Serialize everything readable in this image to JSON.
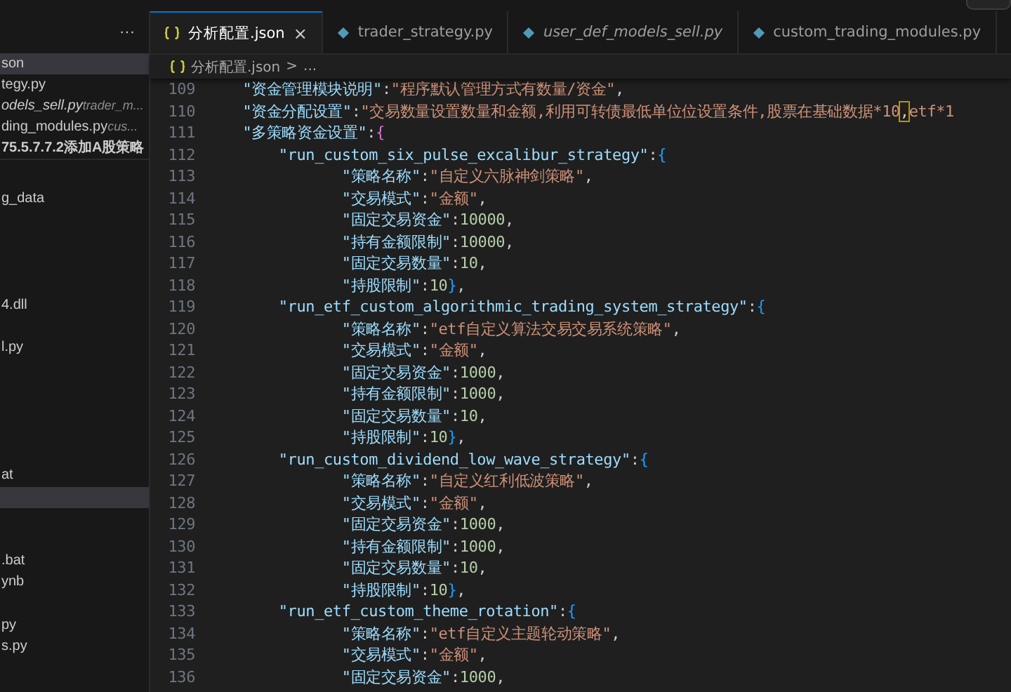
{
  "sidebar": {
    "more": "···",
    "open_editors": [
      {
        "label": "son",
        "selected": true,
        "italic": false
      },
      {
        "label": "tegy.py",
        "selected": false,
        "italic": false
      },
      {
        "label": "odels_sell.py",
        "detail": "trader_m...",
        "selected": false,
        "italic": true
      },
      {
        "label": "ding_modules.py",
        "detail": "cus...",
        "selected": false,
        "italic": false
      }
    ],
    "folder": "75.5.7.7.2添加A股策略",
    "tree": [
      {
        "label": "g_data",
        "selected": false
      },
      {
        "selected": false
      },
      {
        "selected": false
      },
      {
        "selected": false
      },
      {
        "selected": false
      },
      {
        "label": "4.dll",
        "selected": false
      },
      {
        "selected": false
      },
      {
        "label": "l.py",
        "selected": false
      },
      {
        "selected": false
      },
      {
        "selected": false
      },
      {
        "selected": false
      },
      {
        "selected": false
      },
      {
        "selected": false
      },
      {
        "label": "at",
        "selected": false
      },
      {
        "selected": true
      },
      {
        "selected": false
      },
      {
        "selected": false
      },
      {
        "label": ".bat",
        "selected": false
      },
      {
        "label": "ynb",
        "selected": false
      },
      {
        "selected": false
      },
      {
        "label": "py",
        "selected": false
      },
      {
        "label": "s.py",
        "selected": false
      }
    ]
  },
  "tabs": [
    {
      "label": "分析配置.json",
      "kind": "json",
      "selected": true,
      "italic": false,
      "close": "×"
    },
    {
      "label": "trader_strategy.py",
      "kind": "python",
      "selected": false,
      "italic": false
    },
    {
      "label": "user_def_models_sell.py",
      "kind": "python",
      "selected": false,
      "italic": true
    },
    {
      "label": "custom_trading_modules.py",
      "kind": "python",
      "selected": false,
      "italic": false
    }
  ],
  "breadcrumb": {
    "file": "分析配置.json",
    "separator": ">",
    "more": "..."
  },
  "lines": [
    {
      "number": "109",
      "tokens": [
        {
          "kind": "key",
          "text": "    \"资金管理模块说明\""
        },
        {
          "kind": "punct",
          "text": ":"
        },
        {
          "kind": "str",
          "text": "\"程序默认管理方式有数量/资金\""
        },
        {
          "kind": "punct",
          "text": ","
        }
      ]
    },
    {
      "number": "110",
      "tokens": [
        {
          "kind": "key",
          "text": "    \"资金分配设置\""
        },
        {
          "kind": "punct",
          "text": ":"
        },
        {
          "kind": "str",
          "text": "\"交易数量设置数量和金额,利用可转债最低单位位设置条件,股票在基础数据*10"
        },
        {
          "kind": "match",
          "text": ","
        },
        {
          "kind": "str",
          "text": "etf*1"
        }
      ]
    },
    {
      "number": "111",
      "tokens": [
        {
          "kind": "key",
          "text": "    \"多策略资金设置\""
        },
        {
          "kind": "punct",
          "text": ":"
        },
        {
          "kind": "brace",
          "text": "{",
          "color": "#da70d6"
        }
      ]
    },
    {
      "number": "112",
      "tokens": [
        {
          "kind": "key",
          "text": "        \"run_custom_six_pulse_excalibur_strategy\""
        },
        {
          "kind": "punct",
          "text": ":"
        },
        {
          "kind": "brace",
          "text": "{",
          "color": "#179fff"
        }
      ]
    },
    {
      "number": "113",
      "tokens": [
        {
          "kind": "key",
          "text": "               \"策略名称\""
        },
        {
          "kind": "punct",
          "text": ":"
        },
        {
          "kind": "str",
          "text": "\"自定义六脉神剑策略\""
        },
        {
          "kind": "punct",
          "text": ","
        }
      ]
    },
    {
      "number": "114",
      "tokens": [
        {
          "kind": "key",
          "text": "               \"交易模式\""
        },
        {
          "kind": "punct",
          "text": ":"
        },
        {
          "kind": "str",
          "text": "\"金额\""
        },
        {
          "kind": "punct",
          "text": ","
        }
      ]
    },
    {
      "number": "115",
      "tokens": [
        {
          "kind": "key",
          "text": "               \"固定交易资金\""
        },
        {
          "kind": "punct",
          "text": ":"
        },
        {
          "kind": "num",
          "text": "10000"
        },
        {
          "kind": "punct",
          "text": ","
        }
      ]
    },
    {
      "number": "116",
      "tokens": [
        {
          "kind": "key",
          "text": "               \"持有金额限制\""
        },
        {
          "kind": "punct",
          "text": ":"
        },
        {
          "kind": "num",
          "text": "10000"
        },
        {
          "kind": "punct",
          "text": ","
        }
      ]
    },
    {
      "number": "117",
      "tokens": [
        {
          "kind": "key",
          "text": "               \"固定交易数量\""
        },
        {
          "kind": "punct",
          "text": ":"
        },
        {
          "kind": "num",
          "text": "10"
        },
        {
          "kind": "punct",
          "text": ","
        }
      ]
    },
    {
      "number": "118",
      "tokens": [
        {
          "kind": "key",
          "text": "               \"持股限制\""
        },
        {
          "kind": "punct",
          "text": ":"
        },
        {
          "kind": "num",
          "text": "10"
        },
        {
          "kind": "brace",
          "text": "}",
          "color": "#179fff"
        },
        {
          "kind": "punct",
          "text": ","
        }
      ]
    },
    {
      "number": "119",
      "tokens": [
        {
          "kind": "key",
          "text": "        \"run_etf_custom_algorithmic_trading_system_strategy\""
        },
        {
          "kind": "punct",
          "text": ":"
        },
        {
          "kind": "brace",
          "text": "{",
          "color": "#179fff"
        }
      ]
    },
    {
      "number": "120",
      "tokens": [
        {
          "kind": "key",
          "text": "               \"策略名称\""
        },
        {
          "kind": "punct",
          "text": ":"
        },
        {
          "kind": "str",
          "text": "\"etf自定义算法交易交易系统策略\""
        },
        {
          "kind": "punct",
          "text": ","
        }
      ]
    },
    {
      "number": "121",
      "tokens": [
        {
          "kind": "key",
          "text": "               \"交易模式\""
        },
        {
          "kind": "punct",
          "text": ":"
        },
        {
          "kind": "str",
          "text": "\"金额\""
        },
        {
          "kind": "punct",
          "text": ","
        }
      ]
    },
    {
      "number": "122",
      "tokens": [
        {
          "kind": "key",
          "text": "               \"固定交易资金\""
        },
        {
          "kind": "punct",
          "text": ":"
        },
        {
          "kind": "num",
          "text": "1000"
        },
        {
          "kind": "punct",
          "text": ","
        }
      ]
    },
    {
      "number": "123",
      "tokens": [
        {
          "kind": "key",
          "text": "               \"持有金额限制\""
        },
        {
          "kind": "punct",
          "text": ":"
        },
        {
          "kind": "num",
          "text": "1000"
        },
        {
          "kind": "punct",
          "text": ","
        }
      ]
    },
    {
      "number": "124",
      "tokens": [
        {
          "kind": "key",
          "text": "               \"固定交易数量\""
        },
        {
          "kind": "punct",
          "text": ":"
        },
        {
          "kind": "num",
          "text": "10"
        },
        {
          "kind": "punct",
          "text": ","
        }
      ]
    },
    {
      "number": "125",
      "tokens": [
        {
          "kind": "key",
          "text": "               \"持股限制\""
        },
        {
          "kind": "punct",
          "text": ":"
        },
        {
          "kind": "num",
          "text": "10"
        },
        {
          "kind": "brace",
          "text": "}",
          "color": "#179fff"
        },
        {
          "kind": "punct",
          "text": ","
        }
      ]
    },
    {
      "number": "126",
      "tokens": [
        {
          "kind": "key",
          "text": "        \"run_custom_dividend_low_wave_strategy\""
        },
        {
          "kind": "punct",
          "text": ":"
        },
        {
          "kind": "brace",
          "text": "{",
          "color": "#179fff"
        }
      ]
    },
    {
      "number": "127",
      "tokens": [
        {
          "kind": "key",
          "text": "               \"策略名称\""
        },
        {
          "kind": "punct",
          "text": ":"
        },
        {
          "kind": "str",
          "text": "\"自定义红利低波策略\""
        },
        {
          "kind": "punct",
          "text": ","
        }
      ]
    },
    {
      "number": "128",
      "tokens": [
        {
          "kind": "key",
          "text": "               \"交易模式\""
        },
        {
          "kind": "punct",
          "text": ":"
        },
        {
          "kind": "str",
          "text": "\"金额\""
        },
        {
          "kind": "punct",
          "text": ","
        }
      ]
    },
    {
      "number": "129",
      "tokens": [
        {
          "kind": "key",
          "text": "               \"固定交易资金\""
        },
        {
          "kind": "punct",
          "text": ":"
        },
        {
          "kind": "num",
          "text": "1000"
        },
        {
          "kind": "punct",
          "text": ","
        }
      ]
    },
    {
      "number": "130",
      "tokens": [
        {
          "kind": "key",
          "text": "               \"持有金额限制\""
        },
        {
          "kind": "punct",
          "text": ":"
        },
        {
          "kind": "num",
          "text": "1000"
        },
        {
          "kind": "punct",
          "text": ","
        }
      ]
    },
    {
      "number": "131",
      "tokens": [
        {
          "kind": "key",
          "text": "               \"固定交易数量\""
        },
        {
          "kind": "punct",
          "text": ":"
        },
        {
          "kind": "num",
          "text": "10"
        },
        {
          "kind": "punct",
          "text": ","
        }
      ]
    },
    {
      "number": "132",
      "tokens": [
        {
          "kind": "key",
          "text": "               \"持股限制\""
        },
        {
          "kind": "punct",
          "text": ":"
        },
        {
          "kind": "num",
          "text": "10"
        },
        {
          "kind": "brace",
          "text": "}",
          "color": "#179fff"
        },
        {
          "kind": "punct",
          "text": ","
        }
      ]
    },
    {
      "number": "133",
      "tokens": [
        {
          "kind": "key",
          "text": "        \"run_etf_custom_theme_rotation\""
        },
        {
          "kind": "punct",
          "text": ":"
        },
        {
          "kind": "brace",
          "text": "{",
          "color": "#179fff"
        }
      ]
    },
    {
      "number": "134",
      "tokens": [
        {
          "kind": "key",
          "text": "               \"策略名称\""
        },
        {
          "kind": "punct",
          "text": ":"
        },
        {
          "kind": "str",
          "text": "\"etf自定义主题轮动策略\""
        },
        {
          "kind": "punct",
          "text": ","
        }
      ]
    },
    {
      "number": "135",
      "tokens": [
        {
          "kind": "key",
          "text": "               \"交易模式\""
        },
        {
          "kind": "punct",
          "text": ":"
        },
        {
          "kind": "str",
          "text": "\"金额\""
        },
        {
          "kind": "punct",
          "text": ","
        }
      ]
    },
    {
      "number": "136",
      "tokens": [
        {
          "kind": "key",
          "text": "               \"固定交易资金\""
        },
        {
          "kind": "punct",
          "text": ":"
        },
        {
          "kind": "num",
          "text": "1000"
        },
        {
          "kind": "punct",
          "text": ","
        }
      ]
    }
  ]
}
